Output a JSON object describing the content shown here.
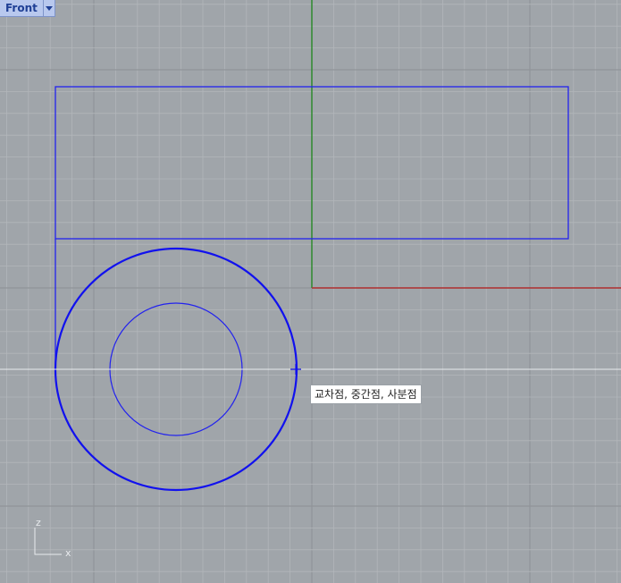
{
  "viewport": {
    "title": "Front",
    "tooltip": "교차점, 중간점, 사분점",
    "axis_icon": {
      "vertical_label": "z",
      "horizontal_label": "x"
    }
  },
  "colors": {
    "background": "#a0a5aa",
    "grid_minor": "#b2b6ba",
    "grid_major": "#8f9499",
    "y_axis": "#2e8b2e",
    "x_axis": "#b03030",
    "geometry": "#2222ee",
    "selected_outline": "#1111ee",
    "tracking_line": "#e9ecef",
    "tab_background": "#b8c8ee"
  },
  "icons": {
    "tab_dropdown": "chevron-down-icon",
    "snap_marker": "crosshair-icon"
  }
}
